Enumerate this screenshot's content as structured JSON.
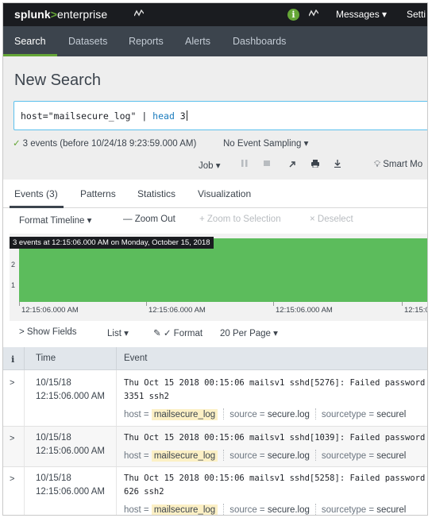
{
  "topbar": {
    "logo_brand": "splunk",
    "logo_arrow": ">",
    "logo_product": "enterprise",
    "activity_icon": "activity-icon",
    "info_icon": "info-icon",
    "messages_label": "Messages ▾",
    "settings_label": "Setti"
  },
  "appbar": {
    "items": [
      "Search",
      "Datasets",
      "Reports",
      "Alerts",
      "Dashboards"
    ],
    "active": "Search",
    "accent": "#65a637"
  },
  "search": {
    "title": "New Search",
    "query_prefix": "host=\"mailsecure_log\" | ",
    "query_cmd": "head",
    "query_suffix": " 3",
    "status_check": "✓",
    "status_text": "3 events (before 10/24/18 9:23:59.000 AM)",
    "sampling": "No Event Sampling ▾",
    "job_label": "Job ▾",
    "smart_mode": "Smart Mo"
  },
  "tabs": {
    "events": "Events (3)",
    "patterns": "Patterns",
    "statistics": "Statistics",
    "visualization": "Visualization"
  },
  "timeline_controls": {
    "format": "Format Timeline ▾",
    "zoom_out": "— Zoom Out",
    "zoom_selection": "+ Zoom to Selection",
    "deselect": "× Deselect"
  },
  "timeline": {
    "tooltip": "3 events at 12:15:06.000 AM on Monday, October 15, 2018",
    "y_labels": [
      "2",
      "1"
    ],
    "x_labels": [
      "12:15:06.000 AM",
      "12:15:06.000 AM",
      "12:15:06.000 AM",
      "12:15:0"
    ],
    "bar_color": "#5cbc5c"
  },
  "results_controls": {
    "show_fields": "> Show Fields",
    "list": "List ▾",
    "format": "✓ Format",
    "per_page": "20 Per Page ▾"
  },
  "table": {
    "col_info": "i",
    "col_time": "Time",
    "col_event": "Event",
    "rows": [
      {
        "expander": ">",
        "date": "10/15/18",
        "time": "12:15:06.000 AM",
        "raw_line1": "Thu Oct 15 2018 00:15:06 mailsv1 sshd[5276]: Failed password f",
        "raw_line2": "3351 ssh2",
        "host_key": "host = ",
        "host_val": "mailsecure_log",
        "source_key": "source = ",
        "source_val": "secure.log",
        "st_key": "sourcetype = ",
        "st_val": "securel"
      },
      {
        "expander": ">",
        "date": "10/15/18",
        "time": "12:15:06.000 AM",
        "raw_line1": "Thu Oct 15 2018 00:15:06 mailsv1 sshd[1039]: Failed password fo",
        "raw_line2": "",
        "host_key": "host = ",
        "host_val": "mailsecure_log",
        "source_key": "source = ",
        "source_val": "secure.log",
        "st_key": "sourcetype = ",
        "st_val": "securel"
      },
      {
        "expander": ">",
        "date": "10/15/18",
        "time": "12:15:06.000 AM",
        "raw_line1": "Thu Oct 15 2018 00:15:06 mailsv1 sshd[5258]: Failed password f",
        "raw_line2": "626 ssh2",
        "host_key": "host = ",
        "host_val": "mailsecure_log",
        "source_key": "source = ",
        "source_val": "secure.log",
        "st_key": "sourcetype = ",
        "st_val": "securel"
      }
    ]
  }
}
